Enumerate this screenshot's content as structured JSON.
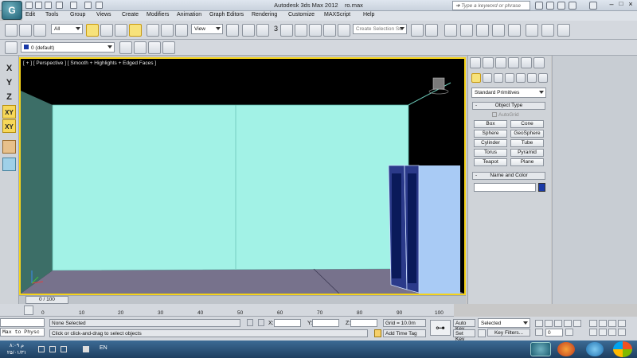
{
  "title_bar": {
    "app_title": "Autodesk 3ds Max  2012",
    "file_name": "ro.max"
  },
  "search": {
    "placeholder": "Type a keyword or phrase"
  },
  "menu": [
    "Edit",
    "Tools",
    "Group",
    "Views",
    "Create",
    "Modifiers",
    "Animation",
    "Graph Editors",
    "Rendering",
    "Customize",
    "MAXScript",
    "Help"
  ],
  "toolbar": {
    "selection_filter": "All",
    "reference_coord": "View",
    "named_selection_placeholder": "Create Selection Se",
    "snap_value": "3"
  },
  "layer_bar": {
    "layer": "0 (default)"
  },
  "axis_constraints": [
    "X",
    "Y",
    "Z",
    "XY",
    "XY"
  ],
  "viewport": {
    "label": "[ + ] [ Perspective ] [ Smooth + Highlights + Edged Faces ]"
  },
  "command_panel": {
    "category": "Standard Primitives",
    "object_type_header": "Object Type",
    "autogrid_label": "AutoGrid",
    "buttons": [
      "Box",
      "Cone",
      "Sphere",
      "GeoSphere",
      "Cylinder",
      "Tube",
      "Torus",
      "Pyramid",
      "Teapot",
      "Plane"
    ],
    "name_color_header": "Name and Color",
    "color": "#1a3aa8"
  },
  "timeline": {
    "frame": "0 / 100"
  },
  "ruler": {
    "ticks": [
      "0",
      "10",
      "20",
      "30",
      "40",
      "50",
      "60",
      "70",
      "80",
      "90",
      "100"
    ]
  },
  "status": {
    "listener_text": "Max to Physc",
    "selection": "None Selected",
    "prompt": "Click or click-and-drag to select objects",
    "x_label": "X:",
    "y_label": "Y:",
    "z_label": "Z:",
    "grid": "Grid = 10.0m",
    "add_time_tag": "Add Time Tag",
    "auto_key": "Auto Key",
    "set_key": "Set Key",
    "key_mode": "Selected",
    "key_filters": "Key Filters...",
    "current_frame": "0"
  },
  "taskbar": {
    "clock_time": "۸:۰۹ م",
    "clock_date": "۲۵/۰۱/۳۱",
    "language": "EN"
  },
  "colors": {
    "viewport_border": "#f5d31a",
    "back_wall": "#a2f2e6",
    "side_wall": "#3c6e67",
    "floor": "#77728c",
    "right_wall": "#a9cbf5",
    "door_frame": "#0a1a5a"
  }
}
